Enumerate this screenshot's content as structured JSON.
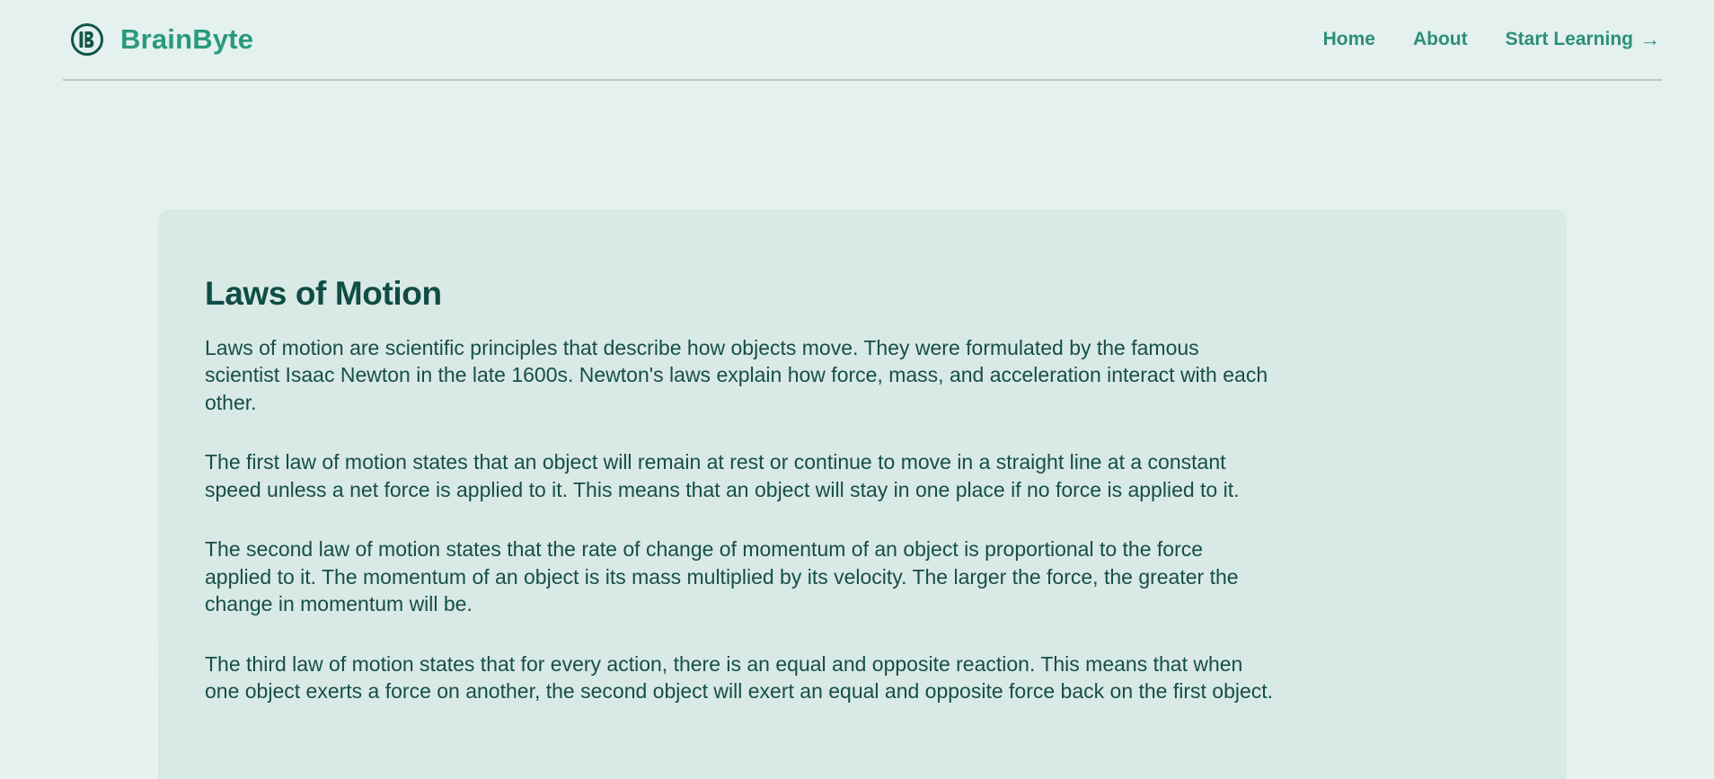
{
  "brand": {
    "name": "BrainByte",
    "logo_icon": "brainbyte-logo-icon"
  },
  "nav": {
    "home": "Home",
    "about": "About",
    "start_learning": "Start Learning",
    "start_learning_icon": "arrow-right-icon",
    "arrow_glyph": "→"
  },
  "article": {
    "title": "Laws of Motion",
    "paragraphs": [
      "Laws of motion are scientific principles that describe how objects move. They were formulated by the famous scientist Isaac Newton in the late 1600s. Newton's laws explain how force, mass, and acceleration interact with each other.",
      "The first law of motion states that an object will remain at rest or continue to move in a straight line at a constant speed unless a net force is applied to it. This means that an object will stay in one place if no force is applied to it.",
      "The second law of motion states that the rate of change of momentum of an object is proportional to the force applied to it. The momentum of an object is its mass multiplied by its velocity. The larger the force, the greater the change in momentum will be.",
      "The third law of motion states that for every action, there is an equal and opposite reaction. This means that when one object exerts a force on another, the second object will exert an equal and opposite force back on the first object."
    ]
  },
  "colors": {
    "background": "#e6f2ef",
    "brand_green": "#2a9a7c",
    "nav_text": "#2c8f78",
    "card_bg": "#d9e9e5",
    "title_text": "#0f4d45",
    "body_text": "#154f47",
    "divider": "#b7cbc7"
  }
}
